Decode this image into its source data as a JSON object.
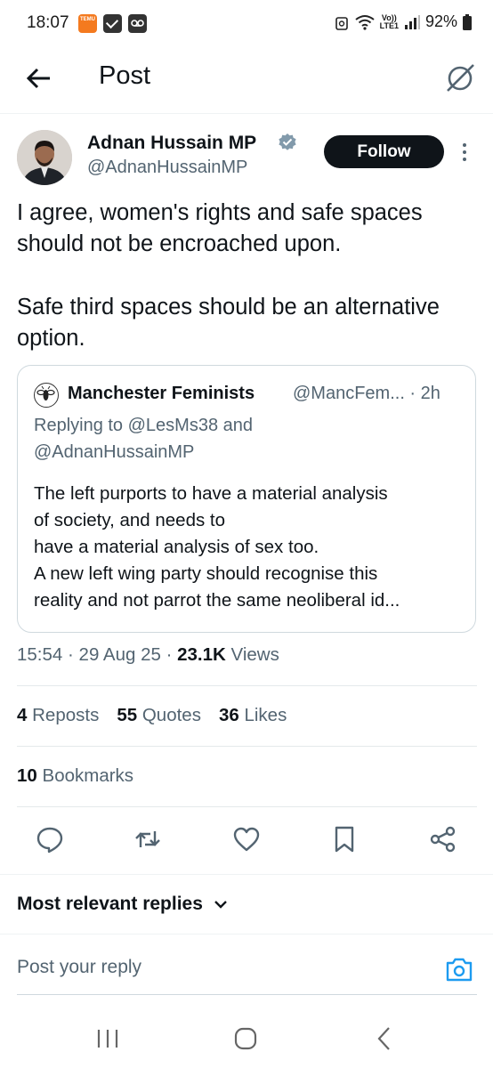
{
  "status_bar": {
    "time": "18:07",
    "temu_label": "TEMU",
    "lte_top": "Vo))",
    "lte_bottom": "LTE1",
    "battery": "92%"
  },
  "header": {
    "title": "Post"
  },
  "author": {
    "name": "Adnan Hussain MP",
    "handle": "@AdnanHussainMP",
    "follow_label": "Follow"
  },
  "tweet": {
    "paragraph_1": "I agree, women's rights and safe spaces should not be encroached upon.",
    "paragraph_2": "Safe third spaces should be an alternative option."
  },
  "quote": {
    "name": "Manchester Feminists",
    "handle_time": "@MancFem... · 2h",
    "replying_line_1": "Replying to @LesMs38 and",
    "replying_line_2": "@AdnanHussainMP",
    "text_lines": [
      "The left purports to have a material analysis",
      "of society, and needs to",
      "have a material analysis of sex too.",
      "A new left wing party should recognise this",
      "reality and not parrot the same neoliberal id..."
    ]
  },
  "meta": {
    "time": "15:54",
    "date": "29 Aug 25",
    "views_count": "23.1K",
    "views_label": "Views",
    "separator": "·"
  },
  "stats": {
    "reposts_count": "4",
    "reposts_label": "Reposts",
    "quotes_count": "55",
    "quotes_label": "Quotes",
    "likes_count": "36",
    "likes_label": "Likes",
    "bookmarks_count": "10",
    "bookmarks_label": "Bookmarks"
  },
  "replies": {
    "filter_label": "Most relevant replies",
    "reply_placeholder": "Post your reply"
  },
  "colors": {
    "primary_text": "#0f1419",
    "secondary_text": "#536471",
    "accent": "#1d9bf0",
    "border": "#cfd9de"
  },
  "icons": {
    "back": "arrow-left-icon",
    "grok": "grok-icon",
    "verified": "verified-badge-icon",
    "more": "more-vertical-icon",
    "reply": "reply-icon",
    "repost": "repost-icon",
    "like": "heart-icon",
    "bookmark": "bookmark-icon",
    "share": "share-icon",
    "chevron": "chevron-down-icon",
    "camera": "camera-icon"
  }
}
